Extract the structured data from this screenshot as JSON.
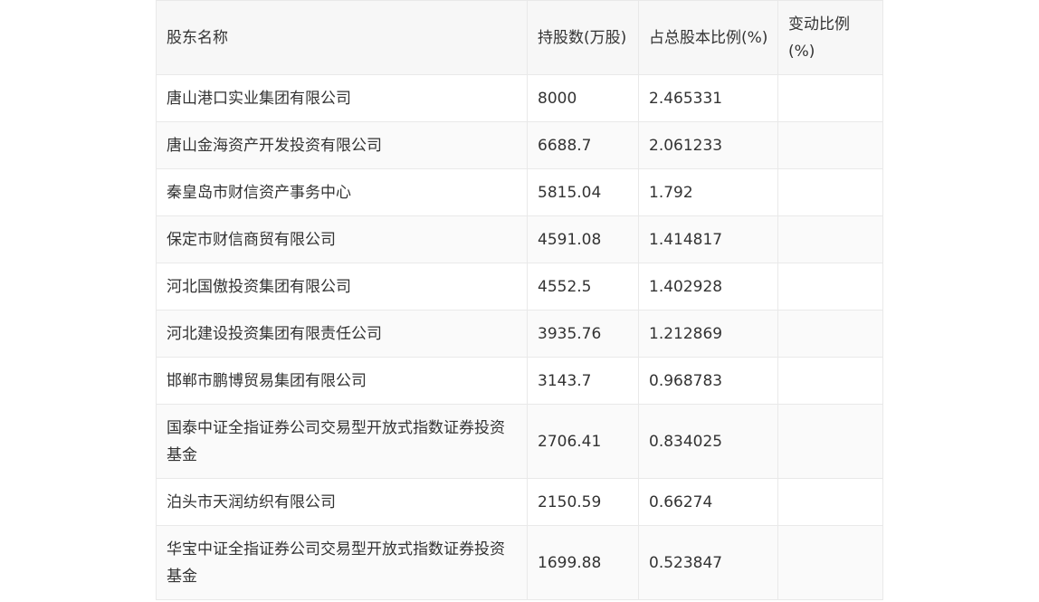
{
  "table": {
    "headers": [
      "股东名称",
      "持股数(万股)",
      "占总股本比例(%)",
      "变动比例(%)"
    ],
    "rows": [
      [
        "唐山港口实业集团有限公司",
        "8000",
        "2.465331",
        ""
      ],
      [
        "唐山金海资产开发投资有限公司",
        "6688.7",
        "2.061233",
        ""
      ],
      [
        "秦皇岛市财信资产事务中心",
        "5815.04",
        "1.792",
        ""
      ],
      [
        "保定市财信商贸有限公司",
        "4591.08",
        "1.414817",
        ""
      ],
      [
        "河北国傲投资集团有限公司",
        "4552.5",
        "1.402928",
        ""
      ],
      [
        "河北建设投资集团有限责任公司",
        "3935.76",
        "1.212869",
        ""
      ],
      [
        "邯郸市鹏博贸易集团有限公司",
        "3143.7",
        "0.968783",
        ""
      ],
      [
        "国泰中证全指证券公司交易型开放式指数证券投资基金",
        "2706.41",
        "0.834025",
        ""
      ],
      [
        "泊头市天润纺织有限公司",
        "2150.59",
        "0.66274",
        ""
      ],
      [
        "华宝中证全指证券公司交易型开放式指数证券投资基金",
        "1699.88",
        "0.523847",
        ""
      ]
    ]
  }
}
